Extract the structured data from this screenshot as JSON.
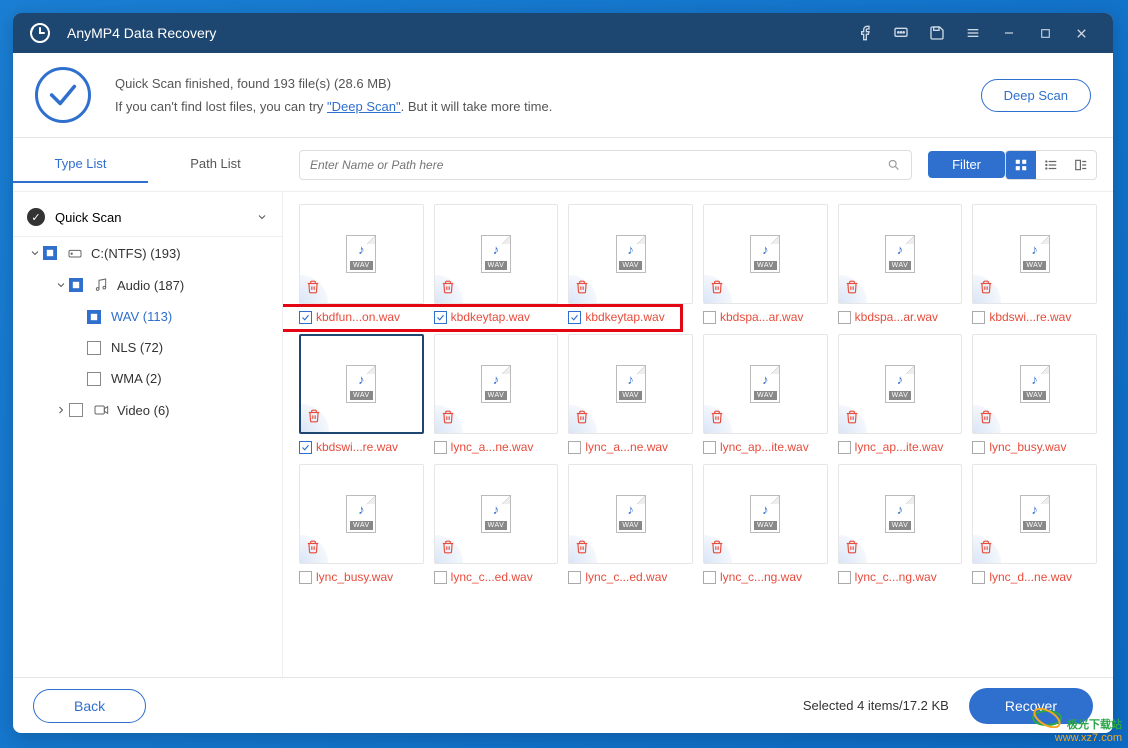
{
  "app": {
    "title": "AnyMP4 Data Recovery"
  },
  "info": {
    "line1": "Quick Scan finished, found 193 file(s) (28.6 MB)",
    "line2a": "If you can't find lost files, you can try ",
    "deep_link": "\"Deep Scan\"",
    "line2b": ". But it will take more time.",
    "deep_scan_btn": "Deep Scan"
  },
  "tabs": {
    "type": "Type List",
    "path": "Path List"
  },
  "search": {
    "placeholder": "Enter Name or Path here"
  },
  "filter_btn": "Filter",
  "sidebar": {
    "quick_scan": "Quick Scan",
    "drive": "C:(NTFS) (193)",
    "audio": "Audio (187)",
    "wav": "WAV (113)",
    "nls": "NLS (72)",
    "wma": "WMA (2)",
    "video": "Video (6)"
  },
  "files": [
    {
      "name": "kbdfun...on.wav",
      "checked": true,
      "selected": false
    },
    {
      "name": "kbdkeytap.wav",
      "checked": true,
      "selected": false
    },
    {
      "name": "kbdkeytap.wav",
      "checked": true,
      "selected": false
    },
    {
      "name": "kbdspa...ar.wav",
      "checked": false,
      "selected": false
    },
    {
      "name": "kbdspa...ar.wav",
      "checked": false,
      "selected": false
    },
    {
      "name": "kbdswi...re.wav",
      "checked": false,
      "selected": false
    },
    {
      "name": "kbdswi...re.wav",
      "checked": true,
      "selected": true
    },
    {
      "name": "lync_a...ne.wav",
      "checked": false,
      "selected": false
    },
    {
      "name": "lync_a...ne.wav",
      "checked": false,
      "selected": false
    },
    {
      "name": "lync_ap...ite.wav",
      "checked": false,
      "selected": false
    },
    {
      "name": "lync_ap...ite.wav",
      "checked": false,
      "selected": false
    },
    {
      "name": "lync_busy.wav",
      "checked": false,
      "selected": false
    },
    {
      "name": "lync_busy.wav",
      "checked": false,
      "selected": false
    },
    {
      "name": "lync_c...ed.wav",
      "checked": false,
      "selected": false
    },
    {
      "name": "lync_c...ed.wav",
      "checked": false,
      "selected": false
    },
    {
      "name": "lync_c...ng.wav",
      "checked": false,
      "selected": false
    },
    {
      "name": "lync_c...ng.wav",
      "checked": false,
      "selected": false
    },
    {
      "name": "lync_d...ne.wav",
      "checked": false,
      "selected": false
    }
  ],
  "footer": {
    "back": "Back",
    "status": "Selected 4 items/17.2 KB",
    "recover": "Recover"
  },
  "watermark": {
    "l1": "极光下载站",
    "l2": "www.xz7.com"
  }
}
